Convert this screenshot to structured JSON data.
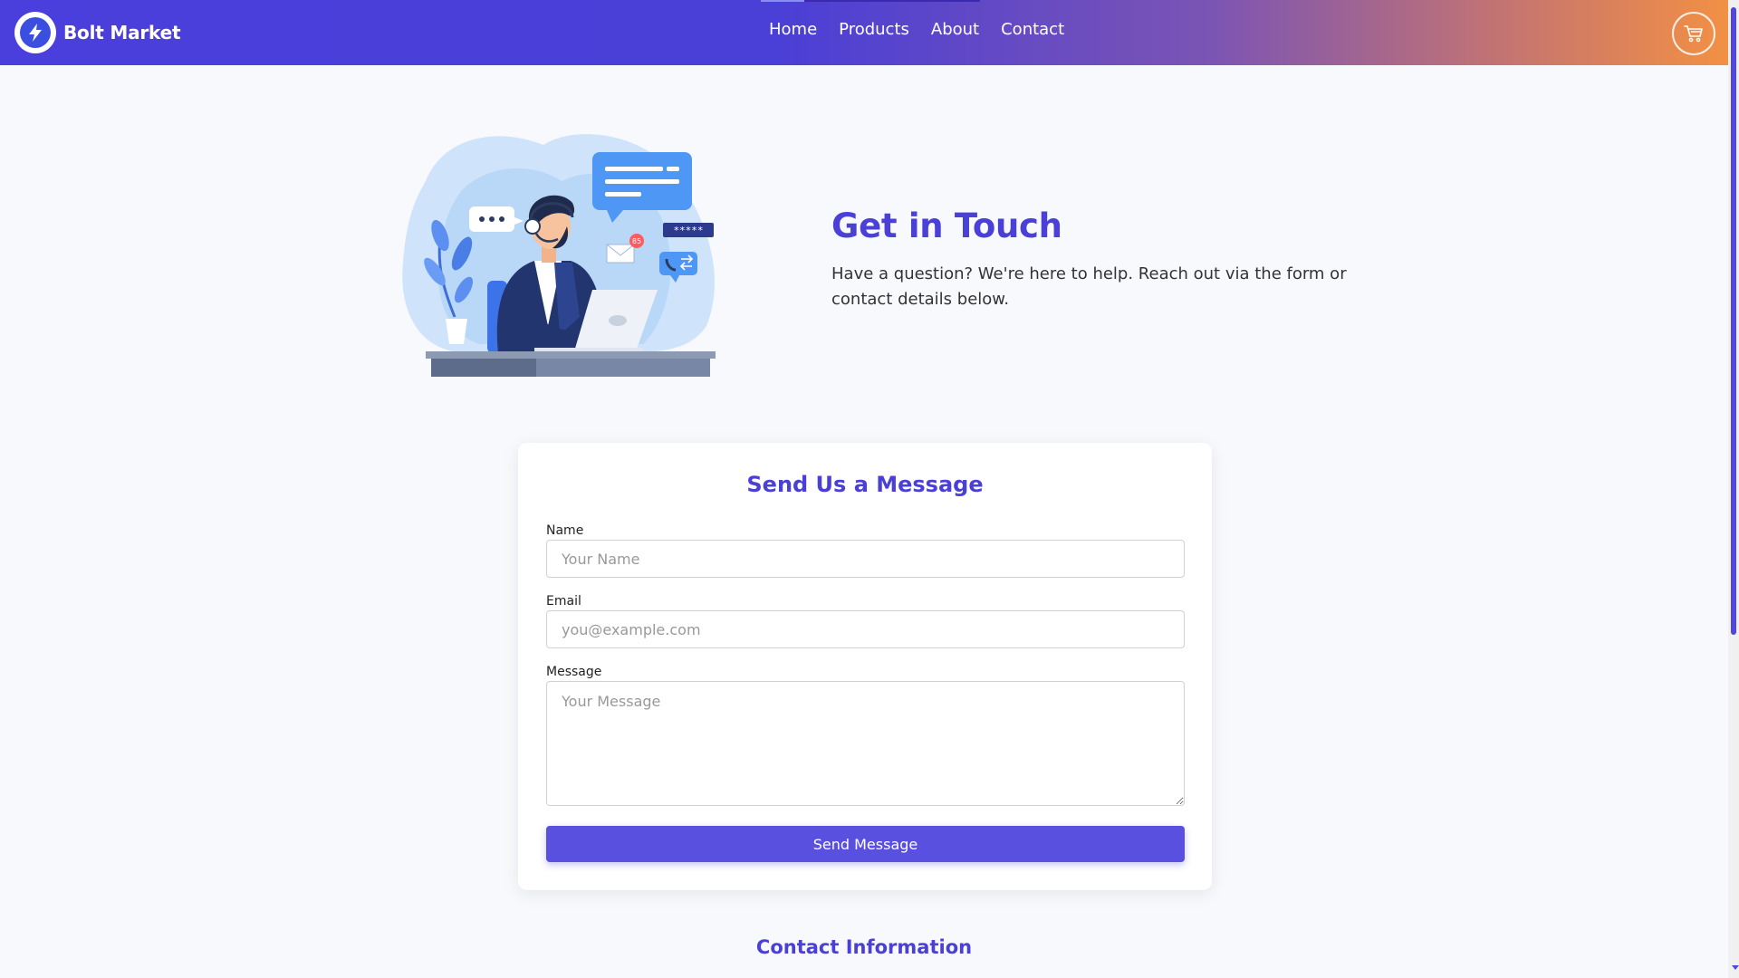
{
  "header": {
    "brand_name": "Bolt Market",
    "nav": [
      "Home",
      "Products",
      "About",
      "Contact"
    ],
    "gradient": [
      "#4a3fdc",
      "#f29044"
    ]
  },
  "hero": {
    "title": "Get in Touch",
    "subtitle": "Have a question? We're here to help. Reach out via the form or contact details below.",
    "illustration": {
      "password_badge": "*****",
      "notification_count": "85"
    }
  },
  "form": {
    "title": "Send Us a Message",
    "name_label": "Name",
    "name_placeholder": "Your Name",
    "email_label": "Email",
    "email_placeholder": "you@example.com",
    "message_label": "Message",
    "message_placeholder": "Your Message",
    "submit_label": "Send Message"
  },
  "contact_info": {
    "title": "Contact Information"
  },
  "colors": {
    "accent": "#4a3fd6",
    "button": "#5a50e0"
  },
  "icons": {
    "brand": "lightning-bolt-icon",
    "cart": "shopping-cart-icon"
  }
}
